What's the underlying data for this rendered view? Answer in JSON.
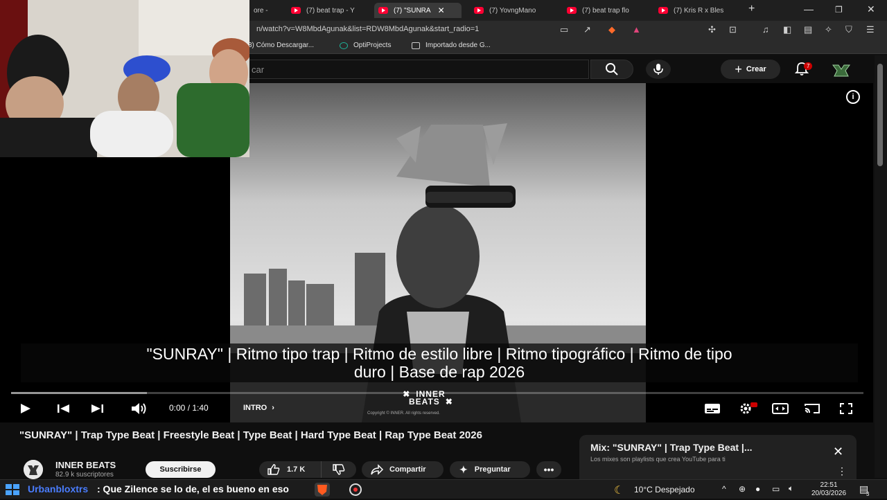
{
  "browser": {
    "tabs": [
      {
        "label": "ore - "
      },
      {
        "label": "(7) beat trap - Y"
      },
      {
        "label": "(7) \"SUNRA"
      },
      {
        "label": "(7) YovngMano"
      },
      {
        "label": "(7) beat trap flo"
      },
      {
        "label": "(7) Kris R x Bles"
      }
    ],
    "new_tab": "+",
    "url": "n/watch?v=W8MbdAgunak&list=RDW8MbdAgunak&start_radio=1",
    "bookmarks": [
      {
        "label": "3) Cómo Descargar..."
      },
      {
        "label": "OptiProjects"
      },
      {
        "label": "Importado desde G..."
      }
    ]
  },
  "youtube": {
    "search_placeholder": "car",
    "create_label": "Crear",
    "notifications_count": "7"
  },
  "player": {
    "caption_line1": "\"SUNRAY\" |  Ritmo tipo trap |  Ritmo de estilo libre |  Ritmo tipográfico |  Ritmo de tipo",
    "caption_line2": "duro |  Base de rap 2026",
    "time": "0:00 / 1:40",
    "chapter": "INTRO",
    "brand_line1": "INNER",
    "brand_line2": "BEATS",
    "brand_copyright": "Copyright © INNER. All rights reserved.",
    "progress_fraction": 0
  },
  "video": {
    "title": "\"SUNRAY\" | Trap Type Beat | Freestyle Beat | Type Beat | Hard Type Beat | Rap Type Beat 2026",
    "channel_name": "INNER BEATS",
    "subscribers": "82.9 k suscriptores",
    "subscribe_label": "Suscribirse",
    "likes": "1.7 K",
    "share_label": "Compartir",
    "ask_label": "Preguntar"
  },
  "mix": {
    "title": "Mix: \"SUNRAY\" | Trap Type Beat |...",
    "subtitle": "Los mixes son playlists que crea YouTube para ti"
  },
  "taskbar": {
    "chat_user": "Urbanbloxtrs",
    "chat_message": ": Que Zilence se lo de, el es bueno en eso",
    "weather": "10°C  Despejado",
    "time": "22:51",
    "date": "20/03/2026",
    "notif_count": "3"
  },
  "colors": {
    "background": "#0f0f0f",
    "youtube_red": "#ff0033",
    "chat_user": "#4a7dff"
  }
}
